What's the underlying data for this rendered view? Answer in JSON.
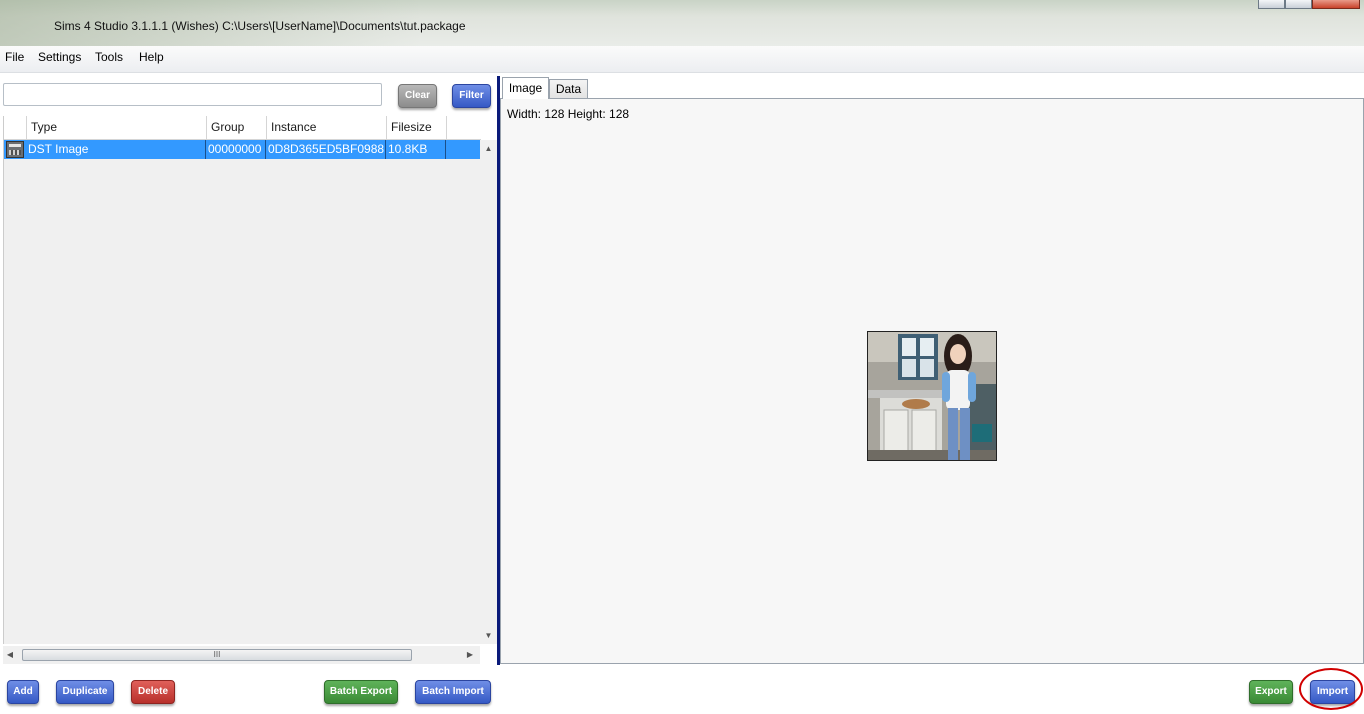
{
  "window": {
    "title": "Sims 4 Studio 3.1.1.1 (Wishes)  C:\\Users\\[UserName]\\Documents\\tut.package"
  },
  "menu": {
    "items": [
      {
        "label": "File"
      },
      {
        "label": "Settings"
      },
      {
        "label": "Tools"
      },
      {
        "label": "Help"
      }
    ]
  },
  "search": {
    "value": "",
    "clear_label": "Clear",
    "filter_label": "Filter"
  },
  "grid": {
    "columns": [
      {
        "label": "Type"
      },
      {
        "label": "Group"
      },
      {
        "label": "Instance"
      },
      {
        "label": "Filesize"
      }
    ],
    "rows": [
      {
        "type": "DST Image",
        "group": "00000000",
        "instance": "0D8D365ED5BF0988",
        "filesize": "10.8KB",
        "selected": true
      }
    ],
    "scroll_thumb_glyph": "III"
  },
  "tabs": [
    {
      "label": "Image",
      "active": true
    },
    {
      "label": "Data",
      "active": false
    }
  ],
  "image_info": {
    "dimensions": "Width: 128 Height: 128"
  },
  "buttons": {
    "add": "Add",
    "duplicate": "Duplicate",
    "delete": "Delete",
    "batch_export": "Batch Export",
    "batch_import": "Batch Import",
    "export": "Export",
    "import": "Import"
  },
  "colors": {
    "selection": "#3399ff",
    "panel_divider": "#0a1a7a",
    "blue_button": "#3559c5",
    "green_button": "#3a8a35",
    "red_button": "#b8302b",
    "gray_button": "#8c8c8c",
    "annotation_ring": "#d10000"
  },
  "icons": {
    "row_icon": "dst-image-icon",
    "minimize": "minimize-icon",
    "maximize": "maximize-icon",
    "close": "close-icon"
  }
}
